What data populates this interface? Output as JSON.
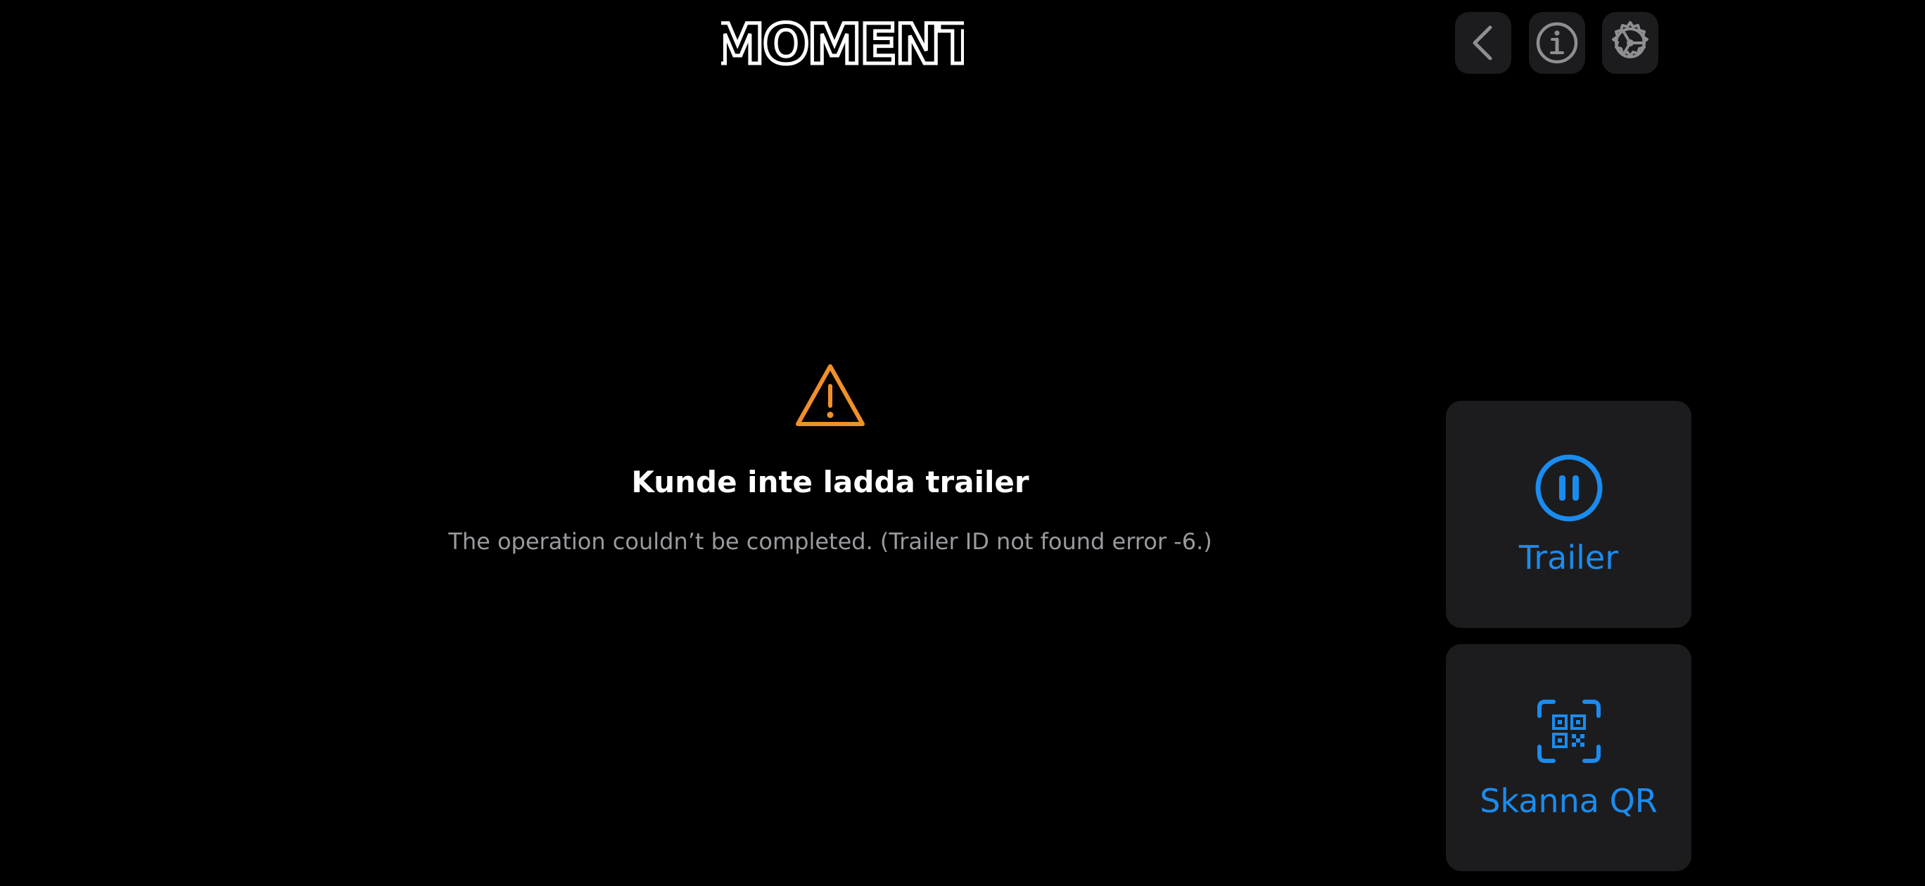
{
  "header": {
    "logo_text": "MOMENT",
    "buttons": [
      {
        "name": "back-button",
        "icon": "chevron-left-icon"
      },
      {
        "name": "info-button",
        "icon": "info-circle-icon"
      },
      {
        "name": "settings-button",
        "icon": "gear-icon"
      }
    ]
  },
  "error": {
    "icon": "warning-triangle-icon",
    "title": "Kunde inte ladda trailer",
    "message": "The operation couldn’t be completed. (Trailer ID not found error -6.)"
  },
  "actions": {
    "trailer_label": "Trailer",
    "trailer_icon": "pause-circle-icon",
    "qr_label": "Skanna QR",
    "qr_icon": "qr-code-scan-icon"
  },
  "colors": {
    "background": "#000000",
    "tile_background": "#1c1c1e",
    "accent_blue": "#1a8cf0",
    "warning_orange": "#f0902a",
    "title_text": "#ffffff",
    "message_text": "#9a9a9f",
    "icon_gray": "#8e8e93"
  }
}
